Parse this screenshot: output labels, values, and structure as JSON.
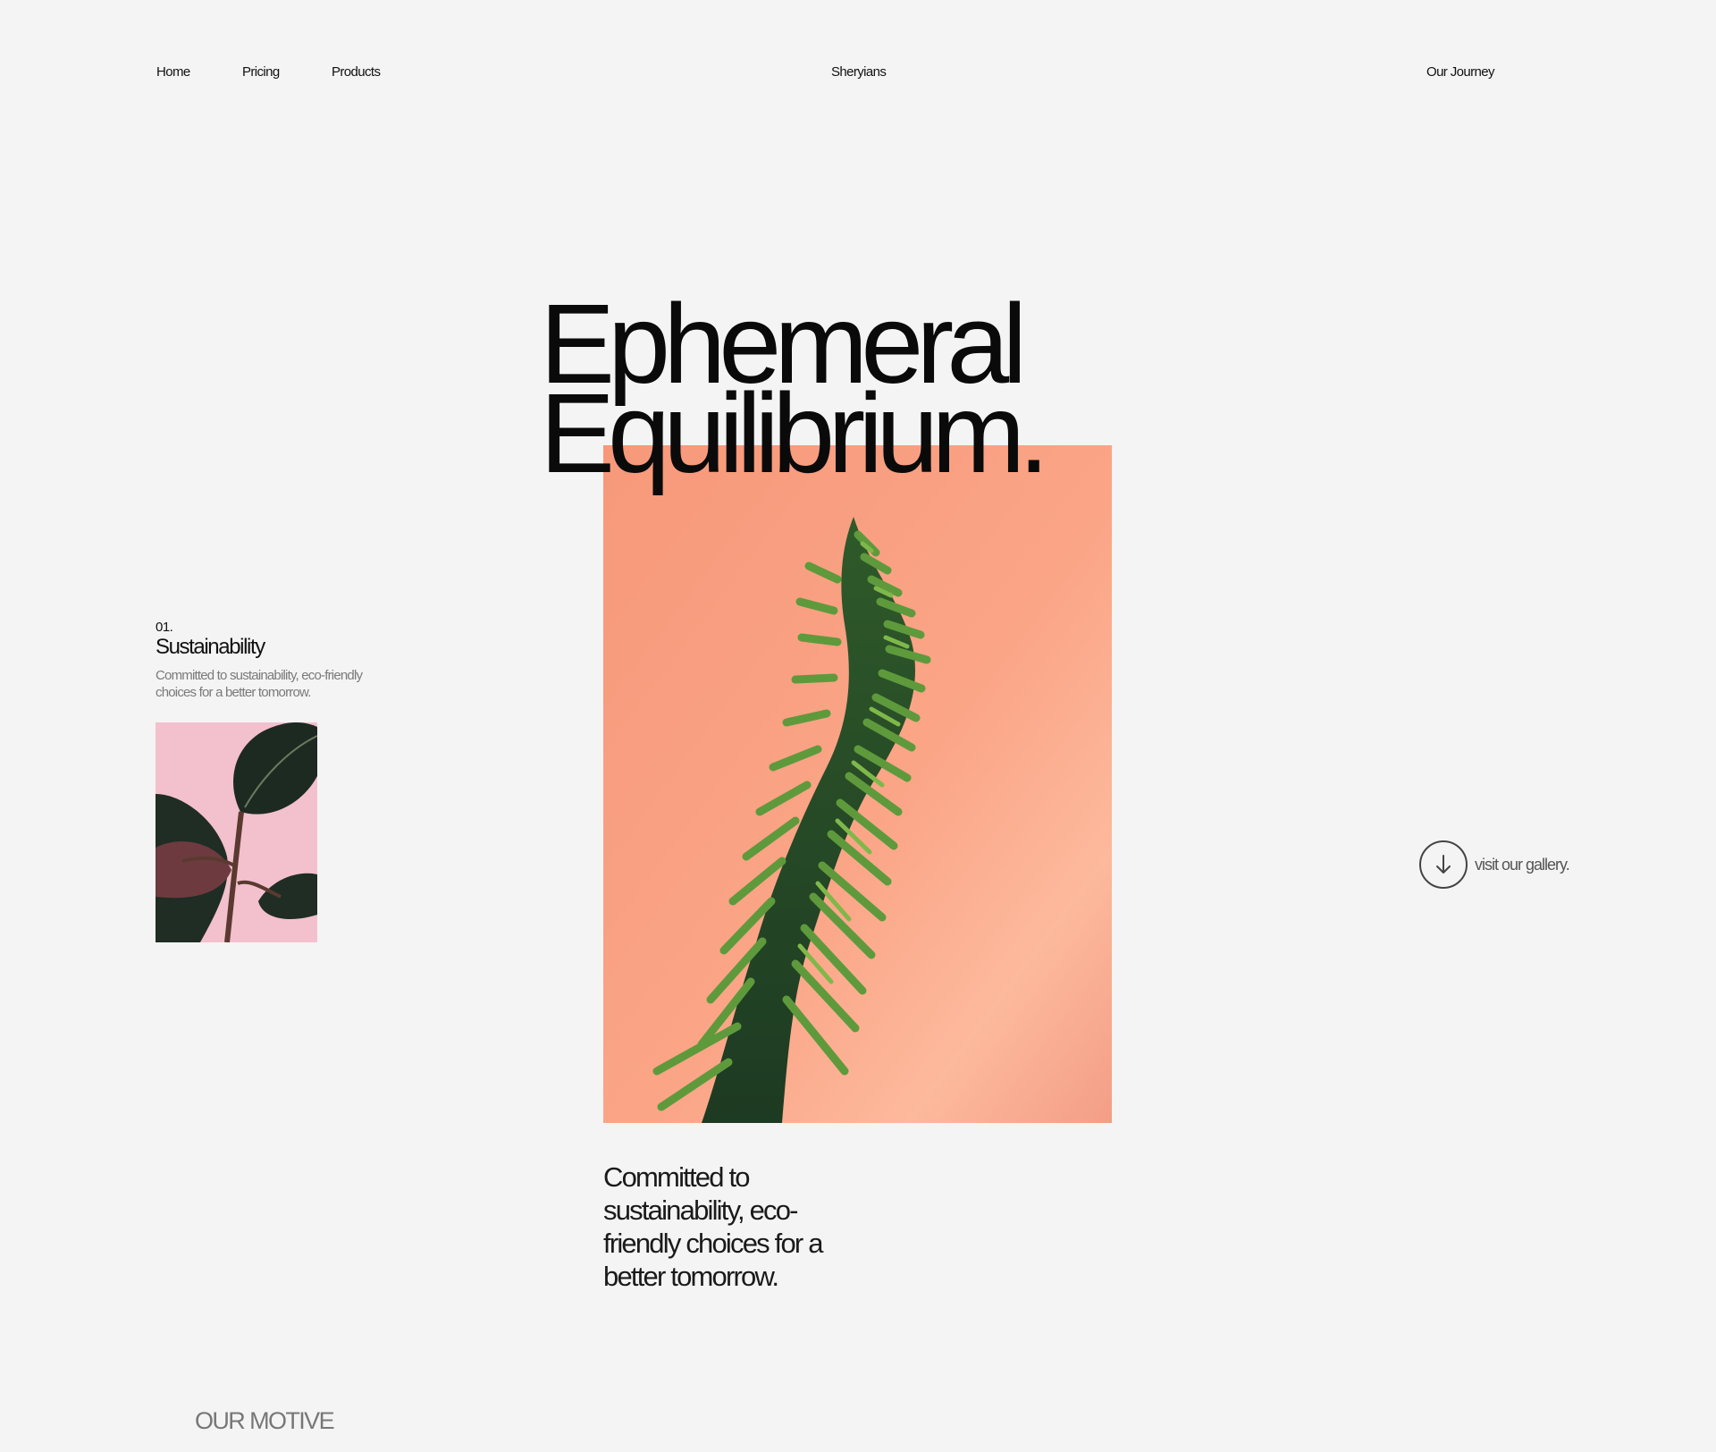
{
  "nav": {
    "home": "Home",
    "pricing": "Pricing",
    "products": "Products",
    "brand": "Sheryians",
    "journey": "Our Journey"
  },
  "hero": {
    "title_line1": "Ephemeral",
    "title_line2": "Equilibrium."
  },
  "feature": {
    "number": "01.",
    "title": "Sustainability",
    "description": "Committed to sustainability, eco-friendly choices for a better tomorrow."
  },
  "gallery": {
    "label": "visit our gallery.",
    "icon": "arrow-down-icon"
  },
  "committed_text": "Committed to sustainability, eco-friendly choices for a better tomorrow.",
  "motive_label": "OUR MOTIVE",
  "colors": {
    "background": "#f4f4f4",
    "hero_bg": "#f79b7d",
    "feature_bg": "#f3c1cf",
    "plant_green": "#3f7a34"
  }
}
